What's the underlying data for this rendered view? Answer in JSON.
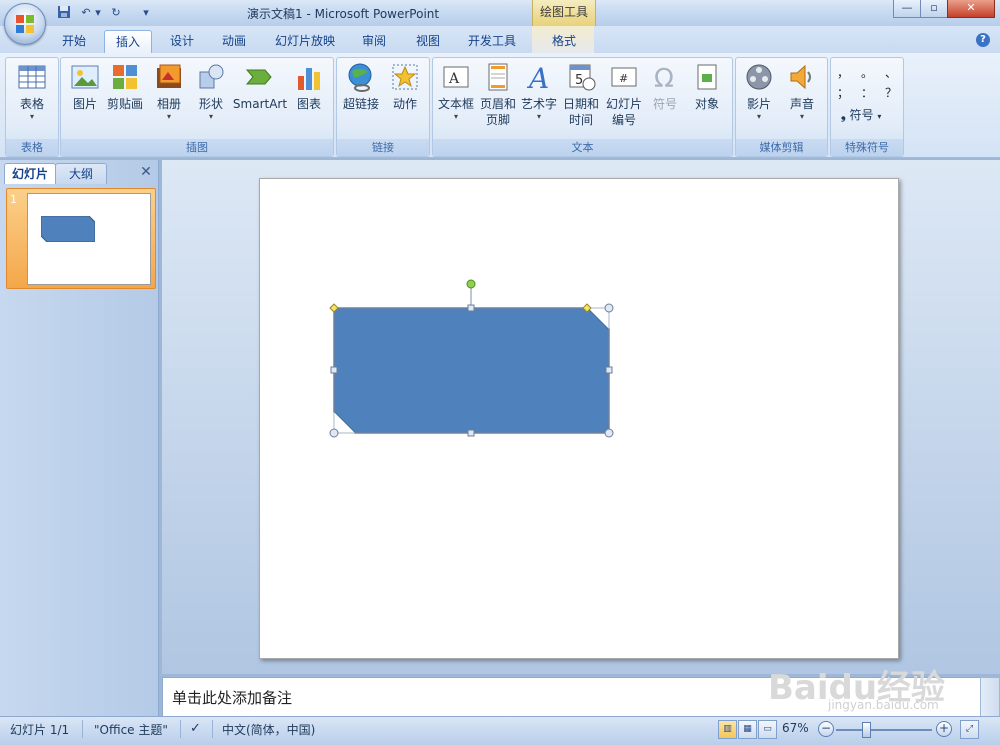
{
  "window": {
    "title": "演示文稿1 - Microsoft PowerPoint",
    "context_tab": "绘图工具"
  },
  "tabs": [
    {
      "label": "开始"
    },
    {
      "label": "插入"
    },
    {
      "label": "设计"
    },
    {
      "label": "动画"
    },
    {
      "label": "幻灯片放映"
    },
    {
      "label": "审阅"
    },
    {
      "label": "视图"
    },
    {
      "label": "开发工具"
    },
    {
      "label": "格式"
    }
  ],
  "ribbon": {
    "table_group": {
      "label": "表格",
      "buttons": [
        {
          "label": "表格"
        }
      ]
    },
    "illustration_group": {
      "label": "插图",
      "buttons": [
        {
          "label": "图片"
        },
        {
          "label": "剪贴画"
        },
        {
          "label": "相册"
        },
        {
          "label": "形状"
        },
        {
          "label": "SmartArt"
        },
        {
          "label": "图表"
        }
      ]
    },
    "link_group": {
      "label": "链接",
      "buttons": [
        {
          "label": "超链接"
        },
        {
          "label": "动作"
        }
      ]
    },
    "text_group": {
      "label": "文本",
      "buttons": [
        {
          "label": "文本框"
        },
        {
          "label": "页眉和",
          "label2": "页脚"
        },
        {
          "label": "艺术字"
        },
        {
          "label": "日期和",
          "label2": "时间"
        },
        {
          "label": "幻灯片",
          "label2": "编号"
        },
        {
          "label": "符号"
        },
        {
          "label": "对象"
        }
      ]
    },
    "media_group": {
      "label": "媒体剪辑",
      "buttons": [
        {
          "label": "影片"
        },
        {
          "label": "声音"
        }
      ]
    },
    "special_group": {
      "label": "特殊符号",
      "symbols": [
        "，",
        "。",
        "、",
        "；",
        "：",
        "？"
      ],
      "button": "符号"
    }
  },
  "left_panel": {
    "tab_slides": "幻灯片",
    "tab_outline": "大纲",
    "close": "✕",
    "thumbnail_number": "1"
  },
  "notes": {
    "placeholder": "单击此处添加备注"
  },
  "status": {
    "slide": "幻灯片 1/1",
    "theme": "\"Office 主题\"",
    "language": "中文(简体，中国)",
    "zoom": "67%"
  },
  "watermark": {
    "brand": "Baidu经验",
    "sub": "jingyan.baidu.com"
  },
  "colors": {
    "shape_fill": "#4f81bd",
    "shape_stroke": "#385d8a",
    "selected_thumb": "#f4a74a",
    "ribbon_text": "#15428b"
  }
}
